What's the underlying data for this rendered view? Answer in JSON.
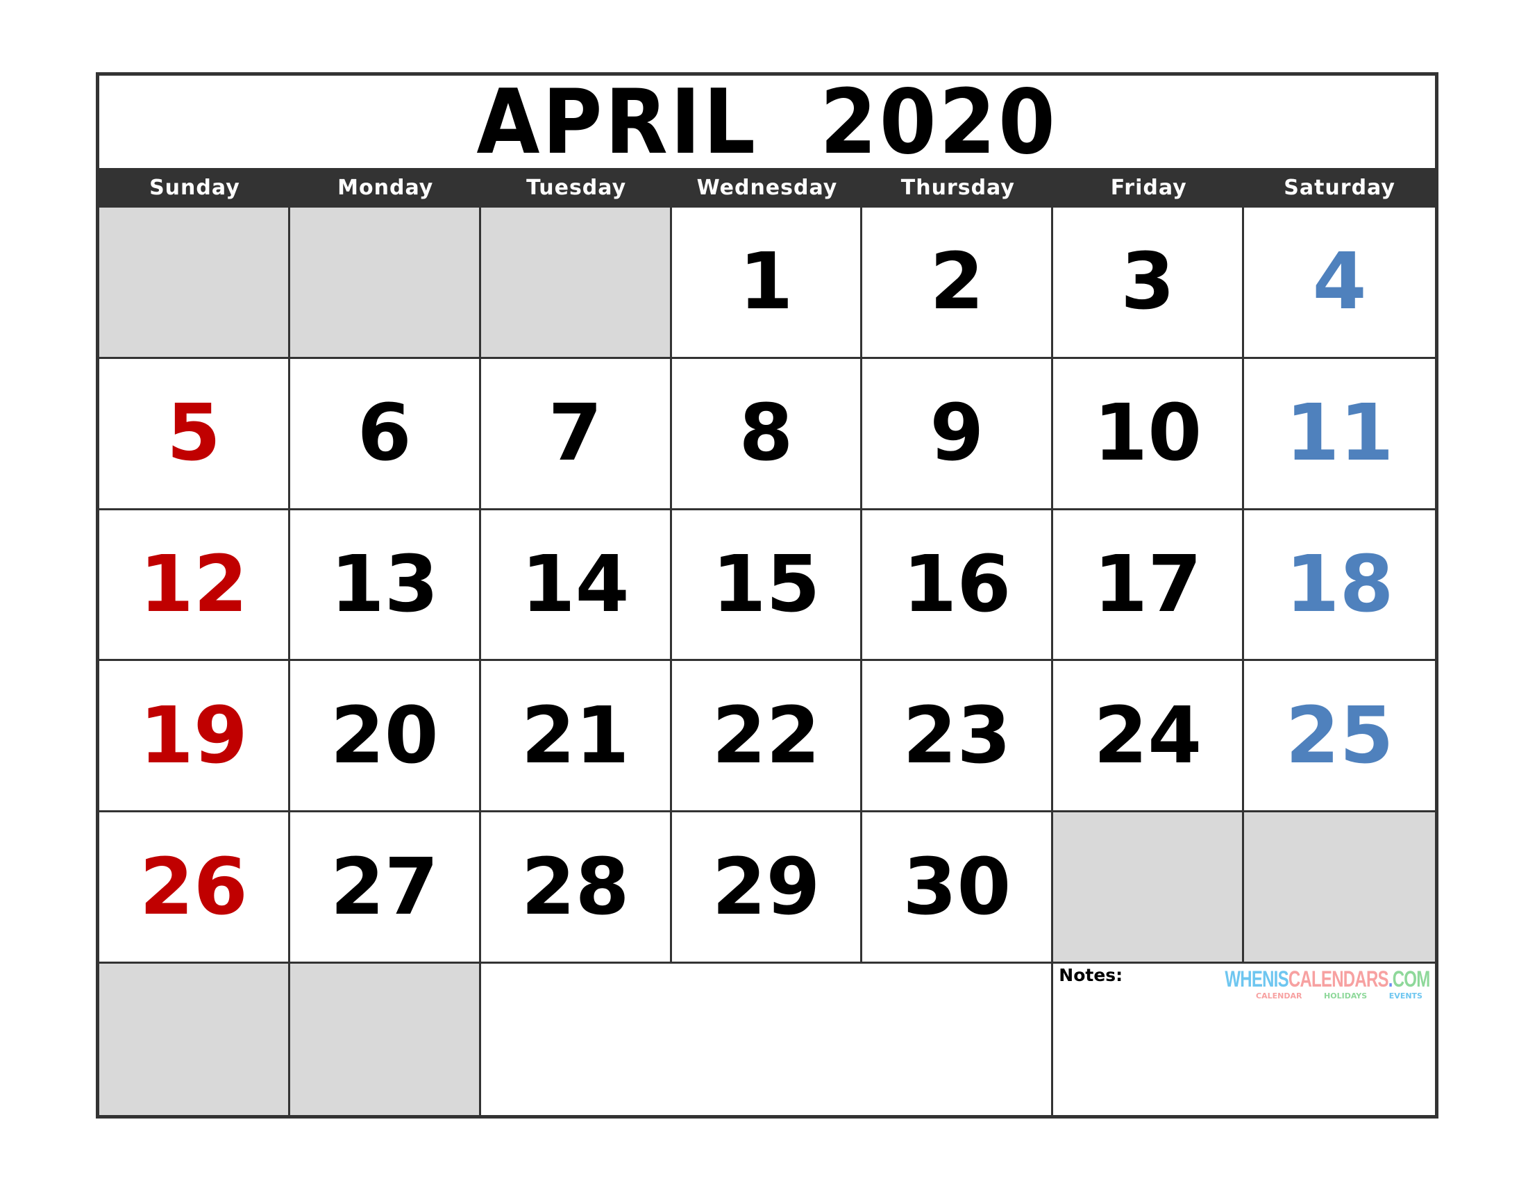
{
  "title": {
    "month": "APRIL",
    "year": "2020"
  },
  "days_of_week": [
    "Sunday",
    "Monday",
    "Tuesday",
    "Wednesday",
    "Thursday",
    "Friday",
    "Saturday"
  ],
  "weeks": [
    [
      "",
      "",
      "",
      "1",
      "2",
      "3",
      "4"
    ],
    [
      "5",
      "6",
      "7",
      "8",
      "9",
      "10",
      "11"
    ],
    [
      "12",
      "13",
      "14",
      "15",
      "16",
      "17",
      "18"
    ],
    [
      "19",
      "20",
      "21",
      "22",
      "23",
      "24",
      "25"
    ],
    [
      "26",
      "27",
      "28",
      "29",
      "30",
      "",
      ""
    ]
  ],
  "last_row": {
    "empty_cells": 2
  },
  "notes": {
    "label": "Notes:"
  },
  "logo": {
    "parts": [
      {
        "text": "WHENIS",
        "color": "#6ec6f0"
      },
      {
        "text": "CALENDARS",
        "color": "#f7a1a1"
      },
      {
        "text": ".",
        "color": "#6b8ef0"
      },
      {
        "text": "COM",
        "color": "#8ed89a"
      }
    ],
    "sub": [
      {
        "text": "CALENDAR",
        "color": "#f7a1a1"
      },
      {
        "text": "HOLIDAYS",
        "color": "#8ed89a"
      },
      {
        "text": "EVENTS",
        "color": "#6ec6f0"
      }
    ]
  },
  "colors": {
    "sunday": "#c00000",
    "saturday": "#4f81bd",
    "weekday": "#000000",
    "header_bar": "#333333",
    "empty_cell": "#d9d9d9"
  }
}
